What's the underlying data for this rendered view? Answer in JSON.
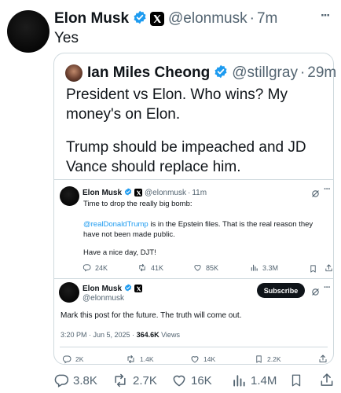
{
  "main_post": {
    "author_name": "Elon Musk",
    "handle": "@elonmusk",
    "separator": "·",
    "time": "7m",
    "text": "Yes",
    "more_label": "···",
    "metrics": {
      "replies": "3.8K",
      "reposts": "2.7K",
      "likes": "16K",
      "views": "1.4M"
    }
  },
  "quoted_post": {
    "author_name": "Ian Miles Cheong",
    "handle": "@stillgray",
    "separator": "·",
    "time": "29m",
    "text_line1": "President vs Elon. Who wins? My money's on Elon.",
    "text_line2": "Trump should be impeached and JD Vance should replace him."
  },
  "inner_post": {
    "author_name": "Elon Musk",
    "handle": "@elonmusk",
    "separator": "·",
    "time": "11m",
    "line1": "Time to drop the really big bomb:",
    "mention": "@realDonaldTrump",
    "line2_rest": " is in the Epstein files. That is the real reason they have not been made public.",
    "line3": "Have a nice day, DJT!",
    "metrics": {
      "replies": "24K",
      "reposts": "41K",
      "likes": "85K",
      "views": "3.3M"
    }
  },
  "expanded_post": {
    "author_name": "Elon Musk",
    "handle": "@elonmusk",
    "subscribe_label": "Subscribe",
    "text": "Mark this post for the future. The truth will come out.",
    "timestamp": "3:20 PM · Jun 5, 2025 · ",
    "views_count": "364.6K",
    "views_label": " Views",
    "metrics": {
      "replies": "2K",
      "reposts": "1.4K",
      "likes": "14K",
      "bookmarks": "2.2K"
    }
  },
  "colors": {
    "verified": "#1d9bf0",
    "link": "#1d9bf0",
    "muted": "#536471",
    "border": "#cfd9de"
  }
}
